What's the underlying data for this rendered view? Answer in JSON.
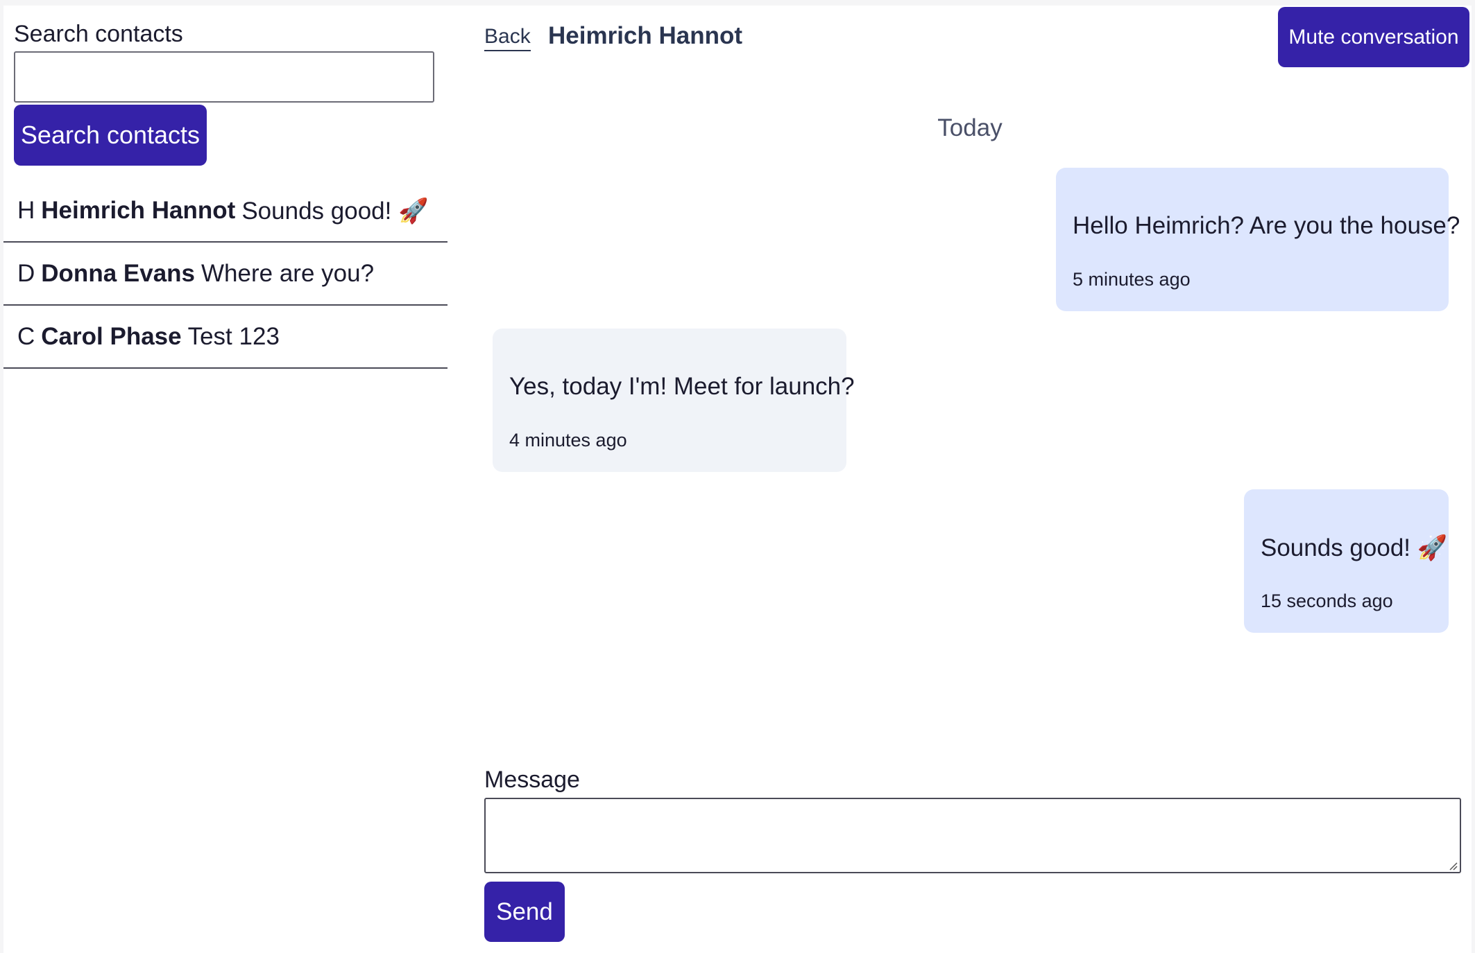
{
  "sidebar": {
    "search_label": "Search contacts",
    "search_value": "",
    "search_button": "Search contacts",
    "contacts": [
      {
        "initial": "H",
        "name": "Heimrich Hannot",
        "preview": "Sounds good! 🚀"
      },
      {
        "initial": "D",
        "name": "Donna Evans",
        "preview": "Where are you?"
      },
      {
        "initial": "C",
        "name": "Carol Phase",
        "preview": "Test 123"
      }
    ]
  },
  "chat": {
    "back_label": "Back",
    "title": "Heimrich Hannot",
    "mute_button": "Mute conversation",
    "date_separator": "Today",
    "messages": [
      {
        "direction": "outgoing",
        "text": "Hello Heimrich? Are you the house?",
        "time": "5 minutes ago"
      },
      {
        "direction": "incoming",
        "text": "Yes, today I'm! Meet for launch?",
        "time": "4 minutes ago"
      },
      {
        "direction": "outgoing",
        "text": "Sounds good! 🚀",
        "time": "15 seconds ago"
      }
    ],
    "message_label": "Message",
    "message_value": "",
    "send_button": "Send"
  },
  "colors": {
    "primary": "#3522a8",
    "outgoing_bubble": "#dde6fe",
    "incoming_bubble": "#f0f3f8",
    "heading": "#2a3550"
  }
}
